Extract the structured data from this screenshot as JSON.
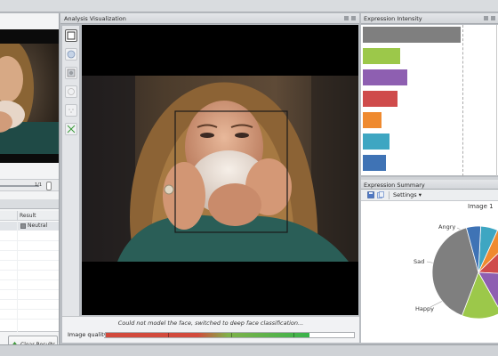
{
  "viz_panel": {
    "title": "Analysis Visualization",
    "status_message": "Could not model the face, switched to deep face classification...",
    "image_quality_label": "Image quality",
    "image_quality": 0.82
  },
  "left_panel": {
    "frame_counter": "1/1",
    "results_header": "Result",
    "results": [
      {
        "label": "Neutral",
        "color": "#8a8d91"
      }
    ],
    "clear_button": "Clear Results"
  },
  "intensity_panel": {
    "title": "Expression Intensity",
    "bars": [
      {
        "color": "#7f7f7f",
        "value": 1.0
      },
      {
        "color": "#9cc84a",
        "value": 0.38
      },
      {
        "color": "#8e5fb1",
        "value": 0.45
      },
      {
        "color": "#cf4b4b",
        "value": 0.35
      },
      {
        "color": "#ef8a2f",
        "value": 0.19
      },
      {
        "color": "#3ea6c2",
        "value": 0.27
      },
      {
        "color": "#3f73b5",
        "value": 0.24
      }
    ]
  },
  "summary_panel": {
    "title": "Expression Summary",
    "settings_label": "Settings",
    "image_label": "Image 1",
    "slice_labels": [
      "Angry",
      "Sad",
      "Happy"
    ]
  },
  "chart_data": {
    "type": "pie",
    "title": "Image 1",
    "slices": [
      {
        "label": "",
        "color": "#3ea6c2",
        "value": 6
      },
      {
        "label": "",
        "color": "#ef8a2f",
        "value": 6
      },
      {
        "label": "Angry",
        "color": "#cf4b4b",
        "value": 13
      },
      {
        "label": "Sad",
        "color": "#8e5fb1",
        "value": 16
      },
      {
        "label": "Happy",
        "color": "#9cc84a",
        "value": 14
      },
      {
        "label": "",
        "color": "#7f7f7f",
        "value": 40
      },
      {
        "label": "",
        "color": "#3f73b5",
        "value": 5
      }
    ]
  }
}
